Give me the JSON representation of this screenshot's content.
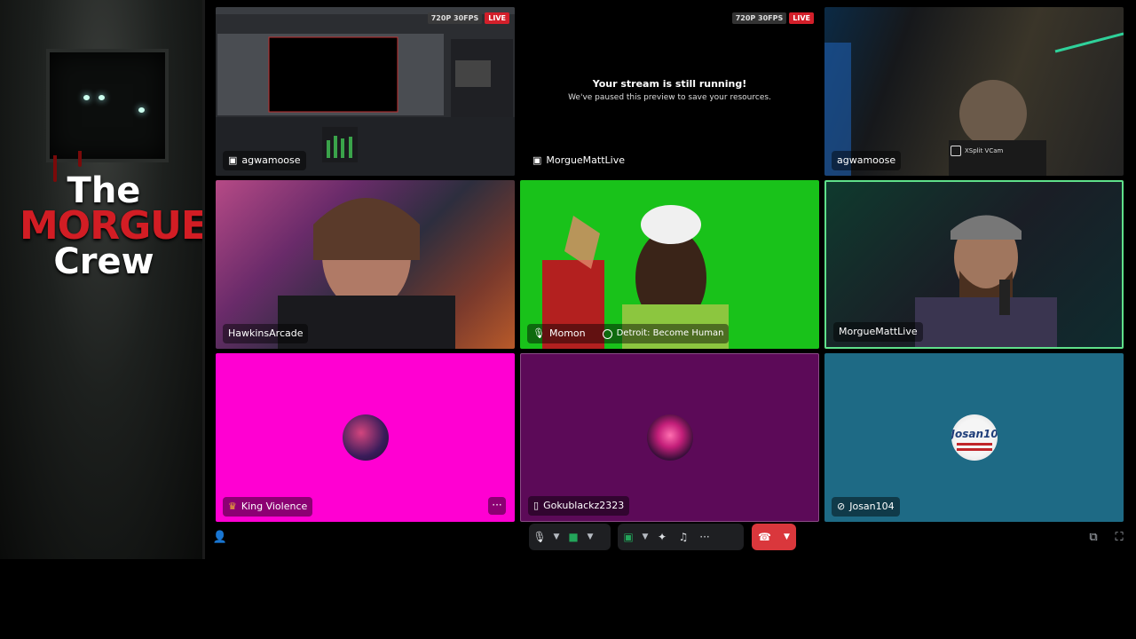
{
  "logo": {
    "line1": "The",
    "line2": "MORGUE",
    "line3": "Crew"
  },
  "tiles": [
    {
      "name": "agwamoose",
      "quality": "720P 30FPS",
      "live": "LIVE"
    },
    {
      "name": "MorgueMattLive",
      "quality": "720P 30FPS",
      "live": "LIVE",
      "paused_title": "Your stream is still running!",
      "paused_sub": "We've paused this preview to save your resources."
    },
    {
      "name": "agwamoose",
      "overlay": "XSplit VCam"
    },
    {
      "name": "HawkinsArcade"
    },
    {
      "name": "Momon",
      "activity": "Detroit: Become Human"
    },
    {
      "name": "MorgueMattLive"
    },
    {
      "name": "King Violence"
    },
    {
      "name": "Gokublackz2323"
    },
    {
      "name": "Josan104",
      "avatar_text": "Josan10"
    }
  ],
  "controls": {
    "more": "···",
    "icons": [
      "mic-icon",
      "camera-icon",
      "screen-share-icon",
      "activities-icon",
      "soundboard-icon",
      "more-icon",
      "hang-up-icon",
      "invite-icon",
      "popout-icon",
      "fullscreen-icon"
    ]
  },
  "colors": {
    "live": "#d21f2a",
    "hangup": "#da373c",
    "speaking_border": "#5fe08a"
  }
}
